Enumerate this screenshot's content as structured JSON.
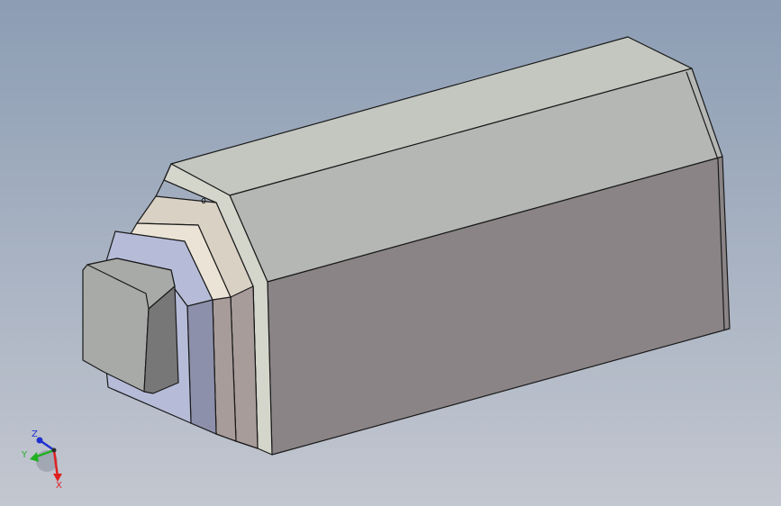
{
  "viewport": {
    "background_top": "#8c9db4",
    "background_bottom": "#c3c7d0"
  },
  "triad": {
    "z_label": "Z",
    "y_label": "Y",
    "x_label": "X",
    "x_color": "#e02020",
    "y_color": "#20b020",
    "z_color": "#2030d0"
  },
  "model": {
    "edge_color": "#1a1a1a",
    "body_top_color": "#c4c7c0",
    "body_upper_color": "#b4b7b3",
    "body_front_color": "#8a8486",
    "body_end_color": "#d4d6cc",
    "flange_face_color": "#d9d1c4",
    "flange_side_color": "#a89c9a",
    "plate_face_color": "#ebe4d6",
    "collar_face_color": "#b6bcd8",
    "collar_side_color": "#8d90aa",
    "cap_face_color": "#a8aaa8",
    "cap_side_color": "#777778"
  }
}
